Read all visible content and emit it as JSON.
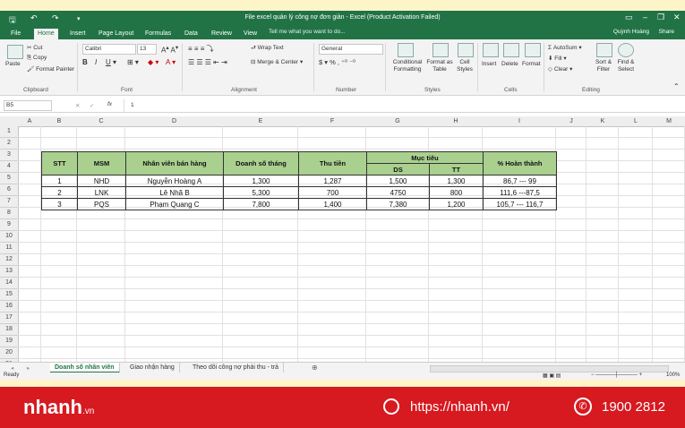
{
  "window": {
    "title": "File excel quản lý công nợ đơn giản - Excel (Product Activation Failed)",
    "user": "Quỳnh Hoàng",
    "share": "Share",
    "tell_me": "Tell me what you want to do..."
  },
  "tabs": [
    "File",
    "Home",
    "Insert",
    "Page Layout",
    "Formulas",
    "Data",
    "Review",
    "View"
  ],
  "ribbon": {
    "clipboard": {
      "cut": "Cut",
      "copy": "Copy",
      "format_painter": "Format Painter",
      "paste": "Paste",
      "label": "Clipboard"
    },
    "font": {
      "name": "Calibri",
      "size": "13",
      "label": "Font"
    },
    "alignment": {
      "wrap": "Wrap Text",
      "merge": "Merge & Center",
      "label": "Alignment"
    },
    "number": {
      "format": "General",
      "label": "Number"
    },
    "styles": {
      "conditional": "Conditional Formatting",
      "format_table": "Format as Table",
      "cell_styles": "Cell Styles",
      "label": "Styles"
    },
    "cells": {
      "insert": "Insert",
      "delete": "Delete",
      "format": "Format",
      "label": "Cells"
    },
    "editing": {
      "autosum": "AutoSum",
      "fill": "Fill",
      "clear": "Clear",
      "sort": "Sort & Filter",
      "find": "Find & Select",
      "label": "Editing"
    }
  },
  "formula_bar": {
    "name_box": "B5",
    "fx": "fx",
    "value": "1"
  },
  "columns": [
    "A",
    "B",
    "C",
    "D",
    "E",
    "F",
    "G",
    "H",
    "I",
    "J",
    "K",
    "L",
    "M"
  ],
  "rows": [
    "1",
    "2",
    "3",
    "4",
    "5",
    "6",
    "7",
    "8",
    "9",
    "10",
    "11",
    "12",
    "13",
    "14",
    "15",
    "16",
    "17",
    "18",
    "19",
    "20",
    "21"
  ],
  "table": {
    "headers": {
      "stt": "STT",
      "msm": "MSM",
      "nv": "Nhân viên bán hàng",
      "ds_thang": "Doanh số tháng",
      "thu_tien": "Thu tiền",
      "muc_tieu": "Mục tiêu",
      "ds": "DS",
      "tt": "TT",
      "hoan_thanh": "% Hoàn thành"
    },
    "rows": [
      [
        "1",
        "NHD",
        "Nguyễn Hoàng A",
        "1,300",
        "1,287",
        "1,500",
        "1,300",
        "86,7 --- 99"
      ],
      [
        "2",
        "LNK",
        "Lê Nhã B",
        "5,300",
        "700",
        "4750",
        "800",
        "111,6 ---87,5"
      ],
      [
        "3",
        "PQS",
        "Phạm Quang C",
        "7,800",
        "1,400",
        "7,380",
        "1,200",
        "105,7 --- 116,7"
      ]
    ]
  },
  "sheets": [
    "Doanh số nhân viên",
    "Giao nhận hàng",
    "Theo dõi công nợ phải thu - trả"
  ],
  "status": {
    "ready": "Ready",
    "zoom": "100%"
  },
  "brand": {
    "logo": "nhanh",
    "logo_tld": ".vn",
    "site": "https://nhanh.vn/",
    "phone": "1900 2812"
  }
}
